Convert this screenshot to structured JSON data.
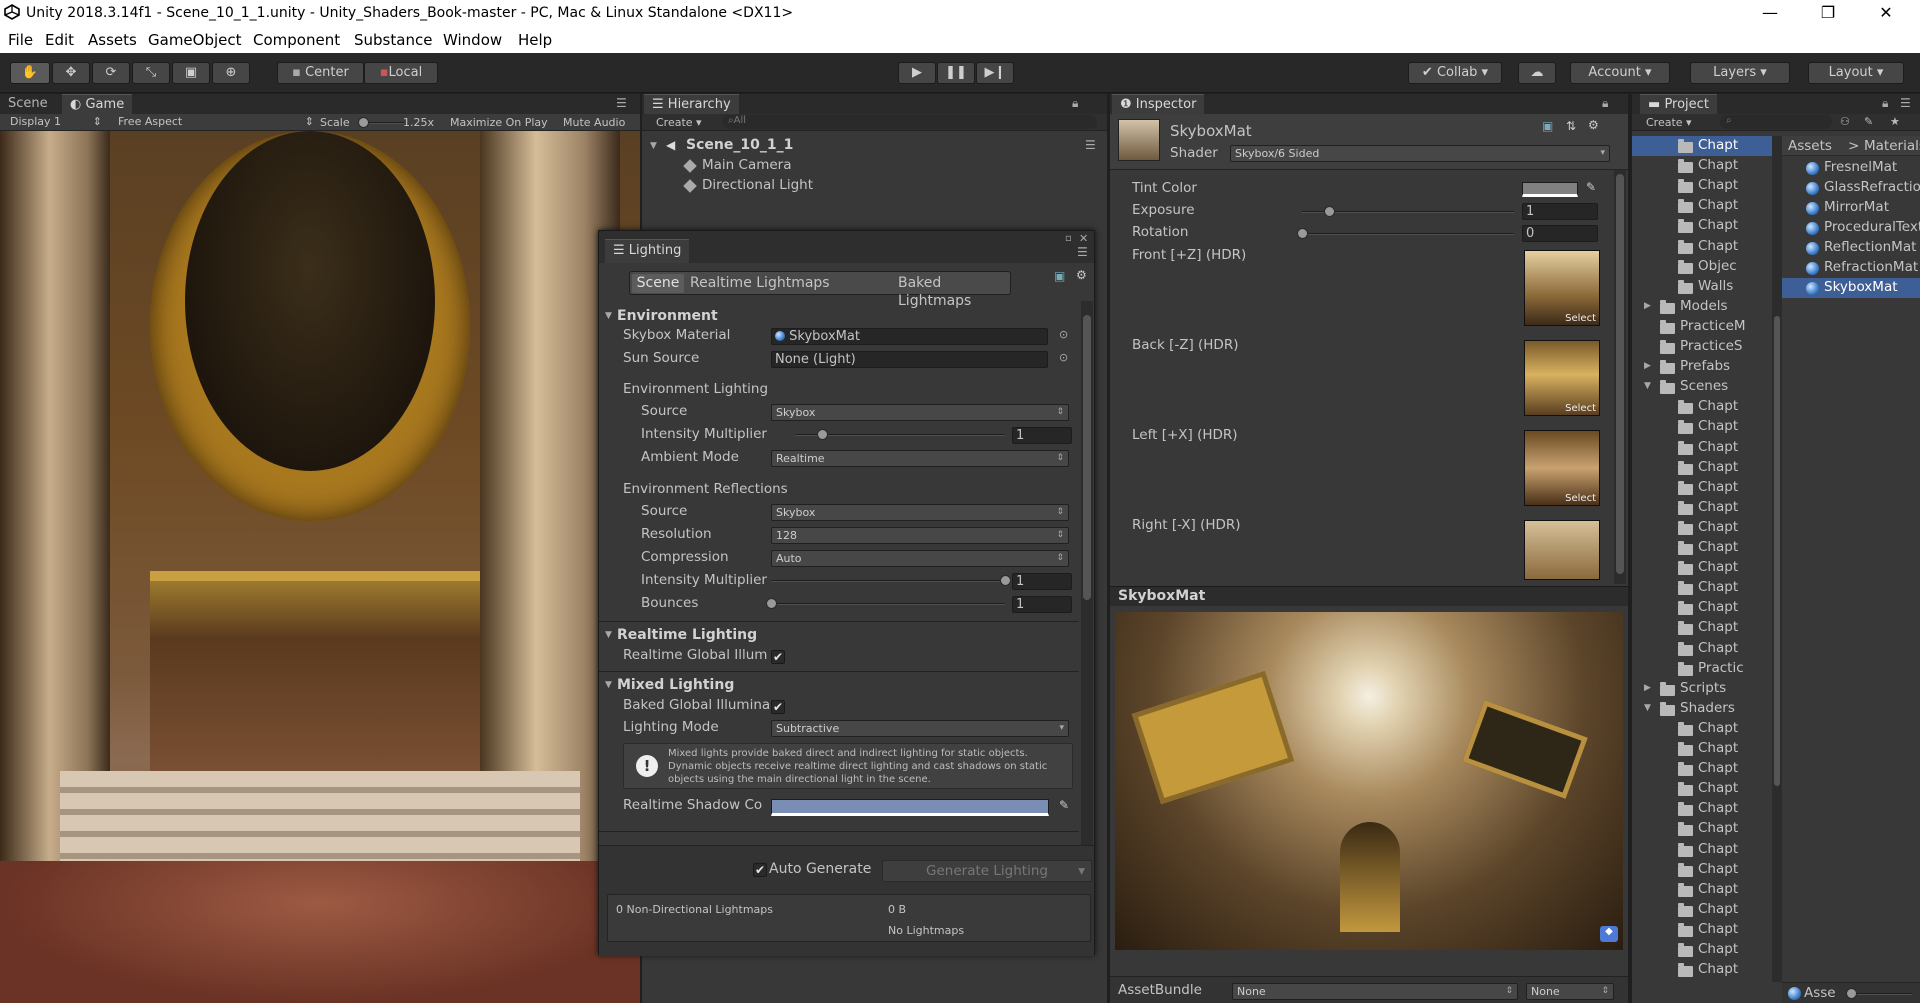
{
  "window": {
    "title": "Unity 2018.3.14f1 - Scene_10_1_1.unity - Unity_Shaders_Book-master - PC, Mac & Linux Standalone <DX11>",
    "minimize": "—",
    "maximize": "❐",
    "close": "✕"
  },
  "menu": [
    "File",
    "Edit",
    "Assets",
    "GameObject",
    "Component",
    "Substance",
    "Window",
    "Help"
  ],
  "toolbar": {
    "center": "Center",
    "local": "Local",
    "collab": "Collab",
    "account": "Account",
    "layers": "Layers",
    "layout": "Layout"
  },
  "game": {
    "tab_scene": "Scene",
    "tab_game": "Game",
    "display": "Display 1",
    "aspect": "Free Aspect",
    "scale_label": "Scale",
    "scale_value": "1.25x",
    "maximize": "Maximize On Play",
    "mute": "Mute Audio"
  },
  "hierarchy": {
    "tab": "Hierarchy",
    "create": "Create",
    "search_placeholder": "All",
    "scene": "Scene_10_1_1",
    "items": [
      "Main Camera",
      "Directional Light"
    ]
  },
  "lighting": {
    "tab": "Lighting",
    "tabs": [
      "Scene",
      "Realtime Lightmaps",
      "Baked Lightmaps"
    ],
    "environment": "Environment",
    "skybox_material_label": "Skybox Material",
    "skybox_material_value": "SkyboxMat",
    "sun_source_label": "Sun Source",
    "sun_source_value": "None (Light)",
    "env_lighting": "Environment Lighting",
    "source_label": "Source",
    "source_value": "Skybox",
    "intensity_label": "Intensity Multiplier",
    "intensity_value": "1",
    "intensity_level": 0.13,
    "ambient_label": "Ambient Mode",
    "ambient_value": "Realtime",
    "env_reflections": "Environment Reflections",
    "refl_source_label": "Source",
    "refl_source_value": "Skybox",
    "resolution_label": "Resolution",
    "resolution_value": "128",
    "compression_label": "Compression",
    "compression_value": "Auto",
    "refl_intensity_label": "Intensity Multiplier",
    "refl_intensity_value": "1",
    "refl_intensity_level": 1.0,
    "bounces_label": "Bounces",
    "bounces_value": "1",
    "bounces_level": 0.0,
    "realtime_lighting": "Realtime Lighting",
    "realtime_gi_label": "Realtime Global Illum",
    "mixed_lighting": "Mixed Lighting",
    "baked_gi_label": "Baked Global Illumina",
    "lighting_mode_label": "Lighting Mode",
    "lighting_mode_value": "Subtractive",
    "info_text": "Mixed lights provide baked direct and indirect lighting for static objects. Dynamic objects receive realtime direct lighting and cast shadows on static objects using the main directional light in the scene.",
    "shadow_color_label": "Realtime Shadow Co",
    "shadow_color": "#7a8db5",
    "auto_generate": "Auto Generate",
    "generate": "Generate Lighting",
    "lightmaps_count": "0 Non-Directional Lightmaps",
    "lightmaps_size": "0 B",
    "no_lightmaps": "No Lightmaps"
  },
  "inspector": {
    "tab": "Inspector",
    "name": "SkyboxMat",
    "shader_label": "Shader",
    "shader_value": "Skybox/6 Sided",
    "tint_label": "Tint Color",
    "exposure_label": "Exposure",
    "exposure_value": "1",
    "exposure_level": 0.125,
    "rotation_label": "Rotation",
    "rotation_value": "0",
    "rotation_level": 0.0,
    "faces": [
      {
        "label": "Front [+Z]   (HDR)",
        "select": "Select"
      },
      {
        "label": "Back [-Z]   (HDR)",
        "select": "Select"
      },
      {
        "label": "Left [+X]   (HDR)",
        "select": "Select"
      },
      {
        "label": "Right [-X]   (HDR)",
        "select": "Select"
      }
    ],
    "preview_title": "SkyboxMat",
    "assetbundle_label": "AssetBundle",
    "assetbundle_value": "None",
    "assetbundle_variant": "None"
  },
  "project": {
    "tab": "Project",
    "create": "Create",
    "breadcrumb_root": "Assets",
    "breadcrumb_sep": ">",
    "breadcrumb_leaf": "Materials",
    "tree": [
      {
        "label": "Chapt",
        "indent": 2,
        "selected": true
      },
      {
        "label": "Chapt",
        "indent": 2
      },
      {
        "label": "Chapt",
        "indent": 2
      },
      {
        "label": "Chapt",
        "indent": 2
      },
      {
        "label": "Chapt",
        "indent": 2
      },
      {
        "label": "Chapt",
        "indent": 2
      },
      {
        "label": "Objec",
        "indent": 2
      },
      {
        "label": "Walls",
        "indent": 2
      },
      {
        "label": "Models",
        "indent": 1,
        "expand": "▶"
      },
      {
        "label": "PracticeM",
        "indent": 1
      },
      {
        "label": "PracticeS",
        "indent": 1
      },
      {
        "label": "Prefabs",
        "indent": 1,
        "expand": "▶"
      },
      {
        "label": "Scenes",
        "indent": 1,
        "expand": "▼"
      },
      {
        "label": "Chapt",
        "indent": 2
      },
      {
        "label": "Chapt",
        "indent": 2
      },
      {
        "label": "Chapt",
        "indent": 2
      },
      {
        "label": "Chapt",
        "indent": 2
      },
      {
        "label": "Chapt",
        "indent": 2
      },
      {
        "label": "Chapt",
        "indent": 2
      },
      {
        "label": "Chapt",
        "indent": 2
      },
      {
        "label": "Chapt",
        "indent": 2
      },
      {
        "label": "Chapt",
        "indent": 2
      },
      {
        "label": "Chapt",
        "indent": 2
      },
      {
        "label": "Chapt",
        "indent": 2
      },
      {
        "label": "Chapt",
        "indent": 2
      },
      {
        "label": "Chapt",
        "indent": 2
      },
      {
        "label": "Practic",
        "indent": 2
      },
      {
        "label": "Scripts",
        "indent": 1,
        "expand": "▶"
      },
      {
        "label": "Shaders",
        "indent": 1,
        "expand": "▼"
      },
      {
        "label": "Chapt",
        "indent": 2
      },
      {
        "label": "Chapt",
        "indent": 2
      },
      {
        "label": "Chapt",
        "indent": 2
      },
      {
        "label": "Chapt",
        "indent": 2
      },
      {
        "label": "Chapt",
        "indent": 2
      },
      {
        "label": "Chapt",
        "indent": 2
      },
      {
        "label": "Chapt",
        "indent": 2
      },
      {
        "label": "Chapt",
        "indent": 2
      },
      {
        "label": "Chapt",
        "indent": 2
      },
      {
        "label": "Chapt",
        "indent": 2
      },
      {
        "label": "Chapt",
        "indent": 2
      },
      {
        "label": "Chapt",
        "indent": 2
      },
      {
        "label": "Chapt",
        "indent": 2
      }
    ],
    "materials": [
      {
        "label": "FresnelMat"
      },
      {
        "label": "GlassRefraction"
      },
      {
        "label": "MirrorMat"
      },
      {
        "label": "ProceduralText"
      },
      {
        "label": "ReflectionMat"
      },
      {
        "label": "RefractionMat"
      },
      {
        "label": "SkyboxMat",
        "selected": true
      }
    ],
    "footer": "Asse"
  },
  "colors": {
    "selection": "#3e5f96",
    "accent_blue": "#4c7ad6"
  }
}
